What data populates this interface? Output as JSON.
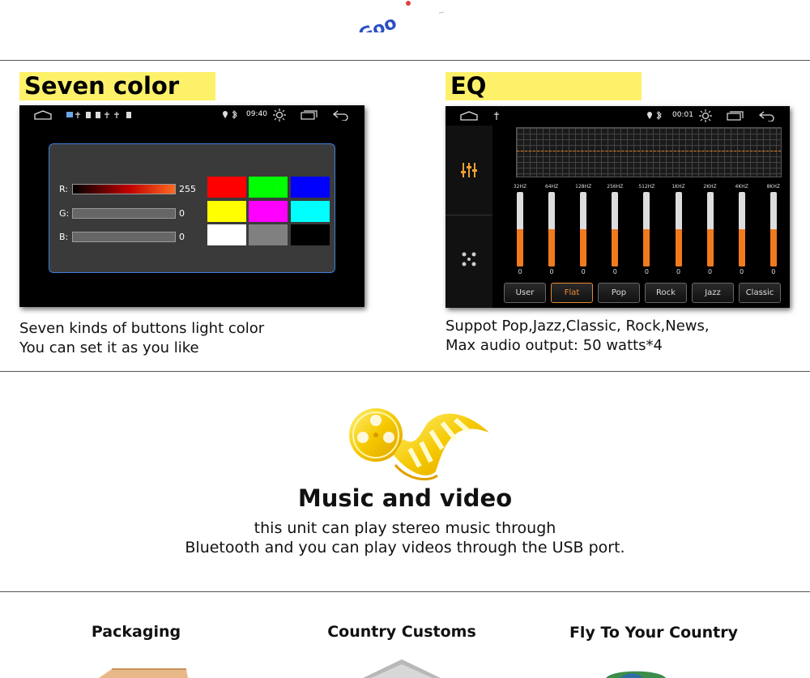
{
  "logo": {
    "text": "Goo"
  },
  "seven_color": {
    "heading": "Seven color",
    "status_time": "09:40",
    "sliders": [
      {
        "label": "R:",
        "value": "255"
      },
      {
        "label": "G:",
        "value": "0"
      },
      {
        "label": "B:",
        "value": "0"
      }
    ],
    "swatches": [
      "#ff0000",
      "#00ff00",
      "#0000ff",
      "#ffff00",
      "#ff00ff",
      "#00ffff",
      "#ffffff",
      "#808080",
      "#000000"
    ],
    "caption_line1": "Seven kinds of buttons light color",
    "caption_line2": "You can set it as you like"
  },
  "eq": {
    "heading": "EQ",
    "status_time": "00:01",
    "bands": [
      {
        "label": "32HZ",
        "value": "0",
        "level": 0.5
      },
      {
        "label": "64HZ",
        "value": "0",
        "level": 0.5
      },
      {
        "label": "128HZ",
        "value": "0",
        "level": 0.5
      },
      {
        "label": "256HZ",
        "value": "0",
        "level": 0.5
      },
      {
        "label": "512HZ",
        "value": "0",
        "level": 0.5
      },
      {
        "label": "1KHZ",
        "value": "0",
        "level": 0.5
      },
      {
        "label": "2KHZ",
        "value": "0",
        "level": 0.5
      },
      {
        "label": "4KHZ",
        "value": "0",
        "level": 0.5
      },
      {
        "label": "8KHZ",
        "value": "0",
        "level": 0.5
      }
    ],
    "presets": [
      {
        "label": "User",
        "active": false
      },
      {
        "label": "Flat",
        "active": true
      },
      {
        "label": "Pop",
        "active": false
      },
      {
        "label": "Rock",
        "active": false
      },
      {
        "label": "Jazz",
        "active": false
      },
      {
        "label": "Classic",
        "active": false
      }
    ],
    "caption_line1": "Suppot Pop,Jazz,Classic, Rock,News,",
    "caption_line2": "Max audio output: 50 watts*4"
  },
  "music": {
    "title": "Music and video",
    "line1": "this unit can play stereo music through",
    "line2": "Bluetooth and you can play videos  through the USB port."
  },
  "bottom": {
    "packaging": "Packaging",
    "customs": "Country Customs",
    "fly": "Fly To Your Country"
  },
  "colors": {
    "highlight": "#fdf16a",
    "accent_orange": "#f07a1e",
    "panel_border": "#3f7fd9"
  }
}
